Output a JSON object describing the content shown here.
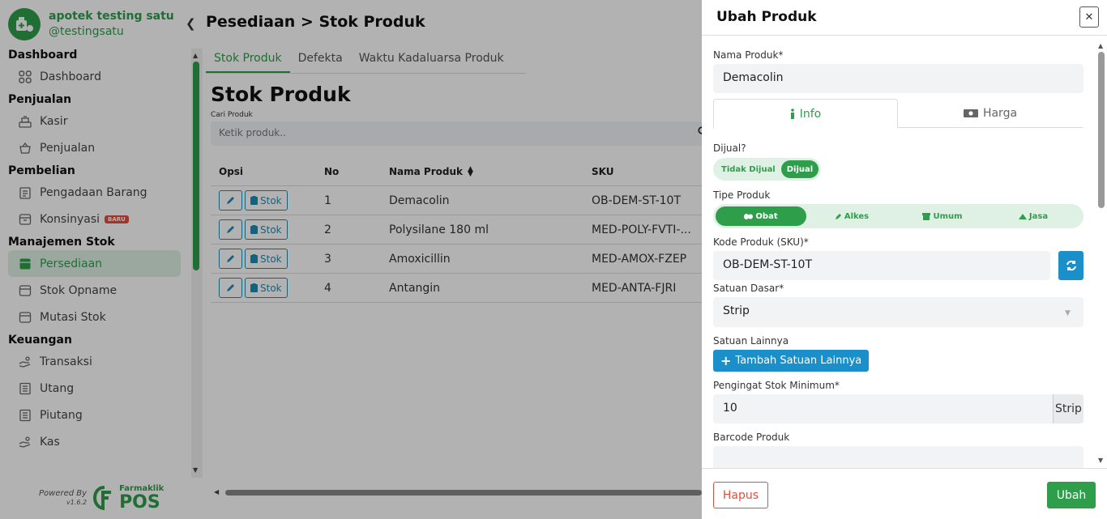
{
  "brand": {
    "name": "apotek testing satu",
    "username": "@testingsatu"
  },
  "sidebar": {
    "sections": [
      {
        "title": "Dashboard",
        "items": [
          {
            "label": "Dashboard",
            "icon": "grid-icon"
          }
        ]
      },
      {
        "title": "Penjualan",
        "items": [
          {
            "label": "Kasir",
            "icon": "cash-register-icon"
          },
          {
            "label": "Penjualan",
            "icon": "basket-icon"
          }
        ]
      },
      {
        "title": "Pembelian",
        "items": [
          {
            "label": "Pengadaan Barang",
            "icon": "clipboard-icon"
          },
          {
            "label": "Konsinyasi",
            "icon": "box-icon",
            "badge": "BARU"
          }
        ]
      },
      {
        "title": "Manajemen Stok",
        "items": [
          {
            "label": "Persediaan",
            "icon": "inventory-icon",
            "active": true
          },
          {
            "label": "Stok Opname",
            "icon": "box-icon"
          },
          {
            "label": "Mutasi Stok",
            "icon": "box-icon"
          }
        ]
      },
      {
        "title": "Keuangan",
        "items": [
          {
            "label": "Transaksi",
            "icon": "hand-icon"
          },
          {
            "label": "Utang",
            "icon": "ledger-icon"
          },
          {
            "label": "Piutang",
            "icon": "ledger-icon"
          },
          {
            "label": "Kas",
            "icon": "hand-icon"
          }
        ]
      }
    ],
    "powered_by": "Powered By",
    "version": "v1.6.2",
    "product_brand": "Farmaklik",
    "product_name": "POS"
  },
  "main": {
    "breadcrumb": "Pesediaan > Stok Produk",
    "tabs": [
      {
        "label": "Stok Produk",
        "active": true
      },
      {
        "label": "Defekta"
      },
      {
        "label": "Waktu Kadaluarsa Produk"
      }
    ],
    "title": "Stok Produk",
    "search": {
      "label": "Cari Produk",
      "placeholder": "Ketik produk.."
    },
    "table": {
      "columns": {
        "opsi": "Opsi",
        "no": "No",
        "nama": "Nama Produk",
        "sku": "SKU"
      },
      "stok_button": "Stok",
      "rows": [
        {
          "no": "1",
          "nama": "Demacolin",
          "sku": "OB-DEM-ST-10T"
        },
        {
          "no": "2",
          "nama": "Polysilane 180 ml",
          "sku": "MED-POLY-FVTI-..."
        },
        {
          "no": "3",
          "nama": "Amoxicillin",
          "sku": "MED-AMOX-FZEP"
        },
        {
          "no": "4",
          "nama": "Antangin",
          "sku": "MED-ANTA-FJRI"
        }
      ]
    }
  },
  "drawer": {
    "title": "Ubah Produk",
    "nama_produk": {
      "label": "Nama Produk*",
      "value": "Demacolin"
    },
    "tabs": {
      "info": "Info",
      "harga": "Harga"
    },
    "dijual": {
      "label": "Dijual?",
      "options": [
        "Tidak Dijual",
        "Dijual"
      ],
      "selected": "Dijual"
    },
    "tipe_produk": {
      "label": "Tipe Produk",
      "options": [
        "Obat",
        "Alkes",
        "Umum",
        "Jasa"
      ],
      "selected": "Obat"
    },
    "kode_produk": {
      "label": "Kode Produk (SKU)*",
      "value": "OB-DEM-ST-10T"
    },
    "satuan_dasar": {
      "label": "Satuan Dasar*",
      "value": "Strip"
    },
    "satuan_lainnya": {
      "label": "Satuan Lainnya",
      "button": "Tambah Satuan Lainnya"
    },
    "stok_minimum": {
      "label": "Pengingat Stok Minimum*",
      "value": "10",
      "unit": "Strip"
    },
    "barcode": {
      "label": "Barcode Produk",
      "value": ""
    },
    "footer": {
      "delete": "Hapus",
      "submit": "Ubah"
    }
  },
  "colors": {
    "brand_green": "#2e9e4b",
    "accent_blue": "#1a8fc9",
    "danger_red": "#e74c3c"
  }
}
